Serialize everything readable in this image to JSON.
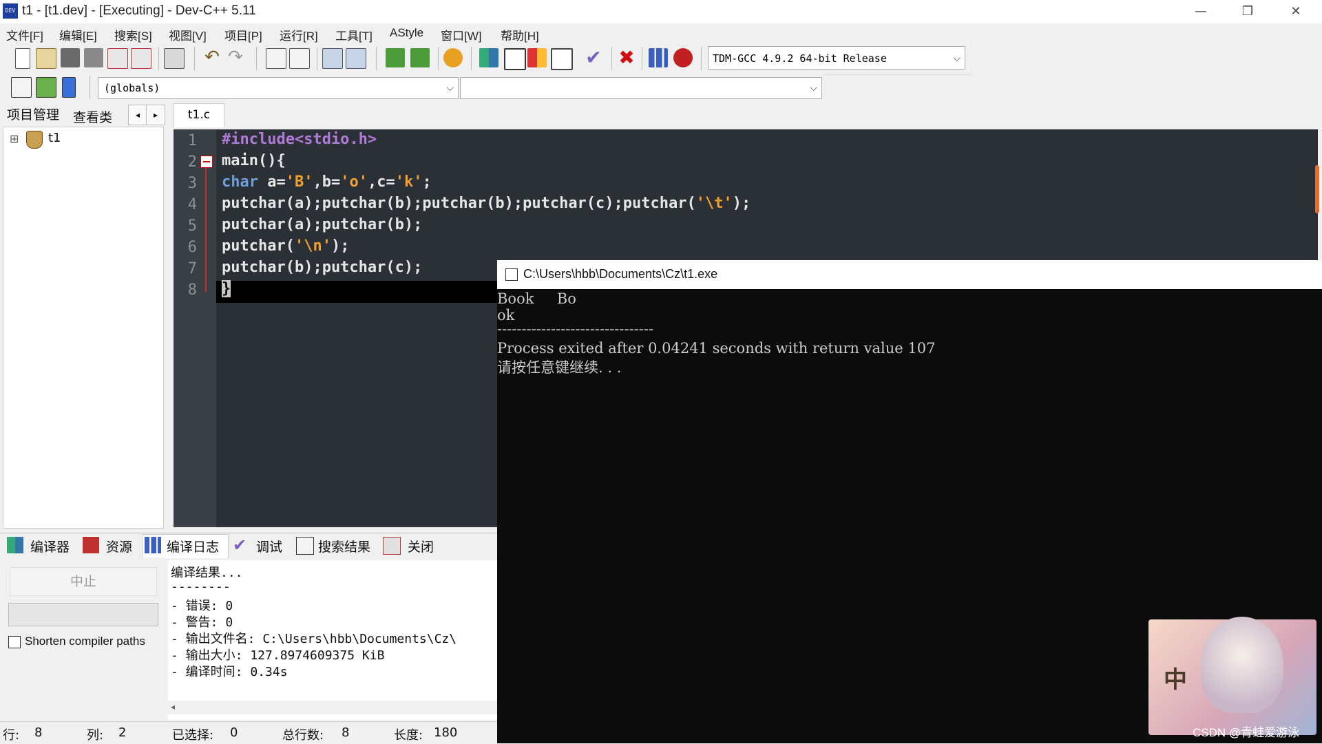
{
  "window": {
    "title": "t1 - [t1.dev] - [Executing] - Dev-C++ 5.11",
    "minimize": "—",
    "restore": "❐",
    "close": "✕"
  },
  "menu": [
    "文件[F]",
    "编辑[E]",
    "搜索[S]",
    "视图[V]",
    "项目[P]",
    "运行[R]",
    "工具[T]",
    "AStyle",
    "窗口[W]",
    "帮助[H]"
  ],
  "toolbar": {
    "compiler": "TDM-GCC 4.9.2 64-bit Release",
    "scope": "(globals)",
    "function": "",
    "icons": [
      "new-file-icon",
      "open-icon",
      "save-icon",
      "save-all-icon",
      "close-icon",
      "close-all-icon",
      "print-icon",
      "undo-icon",
      "redo-icon",
      "find-icon",
      "replace-icon",
      "indent-icon",
      "unindent-icon",
      "add-to-project-icon",
      "remove-from-project-icon",
      "project-options-icon",
      "compile-icon",
      "run-icon",
      "compile-run-icon",
      "rebuild-icon",
      "check-icon",
      "stop-icon",
      "chart-icon",
      "debug-icon"
    ]
  },
  "left_panel": {
    "tabs": [
      "项目管理",
      "查看类"
    ],
    "tree": {
      "root": "t1",
      "expand": "⊞"
    }
  },
  "editor": {
    "tab": "t1.c",
    "line_numbers": [
      "1",
      "2",
      "3",
      "4",
      "5",
      "6",
      "7",
      "8"
    ],
    "lines": [
      {
        "a": "",
        "pp": "#include<stdio.h>",
        "b": "",
        "s": "",
        "c": ""
      },
      {
        "a": "main(){",
        "pp": "",
        "b": "",
        "s": "",
        "c": ""
      },
      {
        "kw": "char",
        "a": " a=",
        "s1": "'B'",
        "b1": ",b=",
        "s2": "'o'",
        "b2": ",c=",
        "s3": "'k'",
        "b3": ";"
      },
      {
        "a": "putchar(a);putchar(b);putchar(b);putchar(c);putchar(",
        "s": "'\\t'",
        "c": ");"
      },
      {
        "a": "putchar(a);putchar(b);"
      },
      {
        "a": "putchar(",
        "s": "'\\n'",
        "c": ");"
      },
      {
        "a": "putchar(b);putchar(c);"
      },
      {
        "a": "}"
      }
    ]
  },
  "bottom": {
    "tabs": [
      "编译器",
      "资源",
      "编译日志",
      "调试",
      "搜索结果",
      "关闭"
    ],
    "stop": "中止",
    "shorten": "Shorten compiler paths",
    "log": [
      "编译结果...",
      "--------",
      "- 错误: 0",
      "- 警告: 0",
      "- 输出文件名: C:\\Users\\hbb\\Documents\\Cz\\",
      "- 输出大小: 127.8974609375 KiB",
      "- 编译时间: 0.34s"
    ]
  },
  "statusbar": {
    "row_label": "行:",
    "row": "8",
    "col_label": "列:",
    "col": "2",
    "sel_label": "已选择:",
    "sel": "0",
    "total_label": "总行数:",
    "total": "8",
    "len_label": "长度:",
    "len": "180"
  },
  "console": {
    "title": "C:\\Users\\hbb\\Documents\\Cz\\t1.exe",
    "lines": [
      "Book     Bo",
      "ok",
      "--------------------------------",
      "Process exited after 0.04241 seconds with return value 107",
      "请按任意键继续. . ."
    ]
  },
  "sticker": {
    "char": "中"
  },
  "watermark": "CSDN @青蛙爱游泳"
}
